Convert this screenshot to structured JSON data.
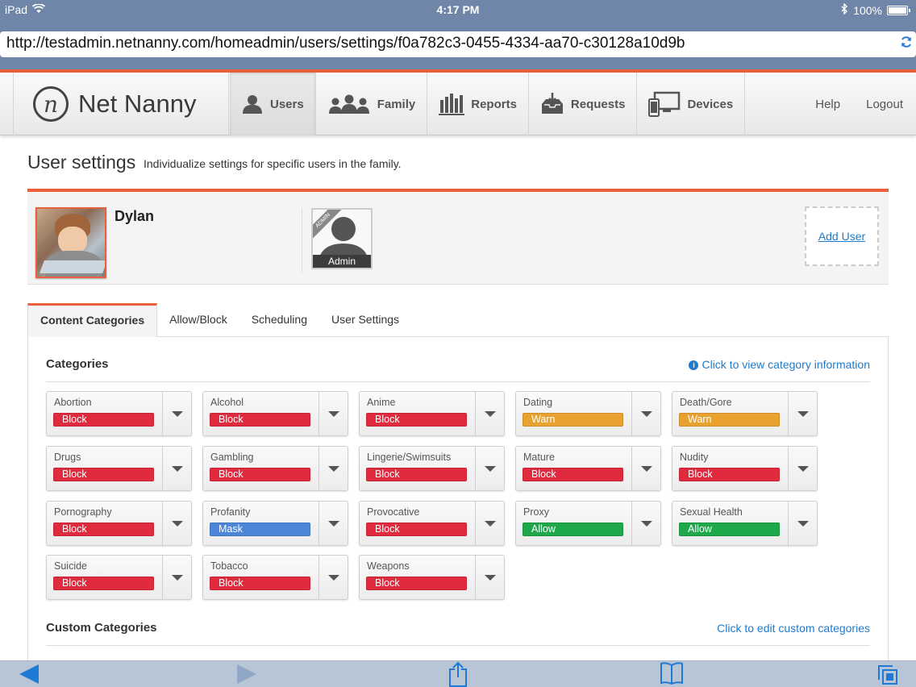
{
  "status_bar": {
    "device": "iPad",
    "time": "4:17 PM",
    "battery": "100%"
  },
  "browser": {
    "url": "http://testadmin.netnanny.com/homeadmin/users/settings/f0a782c3-0455-4334-aa70-c30128a10d9b"
  },
  "app": {
    "logo_mark": "n",
    "logo_text": "Net Nanny",
    "nav": [
      {
        "label": "Users",
        "icon": "user-icon",
        "active": true
      },
      {
        "label": "Family",
        "icon": "family-icon",
        "active": false
      },
      {
        "label": "Reports",
        "icon": "bar-chart-icon",
        "active": false
      },
      {
        "label": "Requests",
        "icon": "inbox-icon",
        "active": false
      },
      {
        "label": "Devices",
        "icon": "devices-icon",
        "active": false
      }
    ],
    "help": "Help",
    "logout": "Logout"
  },
  "page": {
    "title": "User settings",
    "subtitle": "Individualize settings for specific users in the family."
  },
  "users": {
    "current_name": "Dylan",
    "admin_ribbon": "ADMIN",
    "admin_label": "Admin",
    "add_user": "Add User"
  },
  "tabs": [
    {
      "label": "Content Categories",
      "active": true
    },
    {
      "label": "Allow/Block",
      "active": false
    },
    {
      "label": "Scheduling",
      "active": false
    },
    {
      "label": "User Settings",
      "active": false
    }
  ],
  "categories_section": {
    "title": "Categories",
    "info_link": "Click to view category information",
    "items": [
      {
        "name": "Abortion",
        "setting": "Block"
      },
      {
        "name": "Alcohol",
        "setting": "Block"
      },
      {
        "name": "Anime",
        "setting": "Block"
      },
      {
        "name": "Dating",
        "setting": "Warn"
      },
      {
        "name": "Death/Gore",
        "setting": "Warn"
      },
      {
        "name": "Drugs",
        "setting": "Block"
      },
      {
        "name": "Gambling",
        "setting": "Block"
      },
      {
        "name": "Lingerie/Swimsuits",
        "setting": "Block"
      },
      {
        "name": "Mature",
        "setting": "Block"
      },
      {
        "name": "Nudity",
        "setting": "Block"
      },
      {
        "name": "Pornography",
        "setting": "Block"
      },
      {
        "name": "Profanity",
        "setting": "Mask"
      },
      {
        "name": "Provocative",
        "setting": "Block"
      },
      {
        "name": "Proxy",
        "setting": "Allow"
      },
      {
        "name": "Sexual Health",
        "setting": "Allow"
      },
      {
        "name": "Suicide",
        "setting": "Block"
      },
      {
        "name": "Tobacco",
        "setting": "Block"
      },
      {
        "name": "Weapons",
        "setting": "Block"
      }
    ],
    "setting_colors": {
      "Block": "#e02a3e",
      "Warn": "#e9a22f",
      "Mask": "#4c86d8",
      "Allow": "#1ea84a"
    }
  },
  "custom_section": {
    "title": "Custom Categories",
    "edit_link": "Click to edit custom categories"
  },
  "colors": {
    "accent": "#e8603c",
    "link": "#1f7ac9",
    "chrome": "#6f86a8"
  }
}
